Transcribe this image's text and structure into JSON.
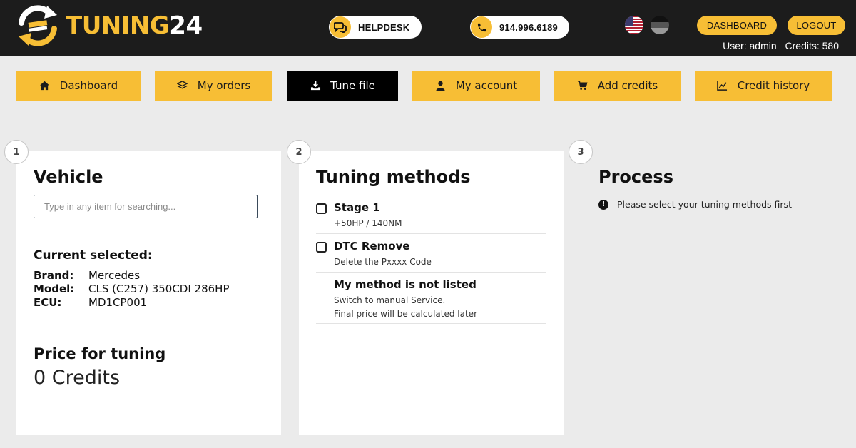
{
  "brand": {
    "part1": "TUNING",
    "part2": "24"
  },
  "header": {
    "helpdesk_label": "HELPDESK",
    "phone_label": "914.996.6189",
    "dashboard_label": "DASHBOARD",
    "logout_label": "LOGOUT",
    "user_text": "User: admin",
    "credits_text": "Credits: 580",
    "languages": [
      "us-flag-icon",
      "de-flag-icon"
    ]
  },
  "nav": {
    "items": [
      {
        "label": "Dashboard",
        "icon": "home-icon"
      },
      {
        "label": "My orders",
        "icon": "layers-icon"
      },
      {
        "label": "Tune file",
        "icon": "download-icon",
        "active": true
      },
      {
        "label": "My account",
        "icon": "user-icon"
      },
      {
        "label": "Add credits",
        "icon": "cart-icon"
      },
      {
        "label": "Credit history",
        "icon": "chart-icon"
      }
    ]
  },
  "steps": {
    "vehicle": {
      "number": "1",
      "title": "Vehicle",
      "search_placeholder": "Type in any item for searching...",
      "current_selected_title": "Current selected:",
      "brand_key": "Brand:",
      "brand_value": "Mercedes",
      "model_key": "Model:",
      "model_value": "CLS (C257) 350CDI 286HP",
      "ecu_key": "ECU:",
      "ecu_value": "MD1CP001",
      "price_title": "Price for tuning",
      "price_value": "0 Credits"
    },
    "methods": {
      "number": "2",
      "title": "Tuning methods",
      "items": [
        {
          "title": "Stage 1",
          "desc": "+50HP / 140NM",
          "checked": false
        },
        {
          "title": "DTC Remove",
          "desc": "Delete the Pxxxx Code",
          "checked": false
        },
        {
          "title": "My method is not listed",
          "desc_line1": "Switch to manual Service.",
          "desc_line2": "Final price will be calculated later"
        }
      ]
    },
    "process": {
      "number": "3",
      "title": "Process",
      "message": "Please select your tuning methods first"
    }
  },
  "colors": {
    "accent": "#f7be35",
    "header_bg": "#1c1c1c",
    "page_bg": "#ebebeb"
  }
}
